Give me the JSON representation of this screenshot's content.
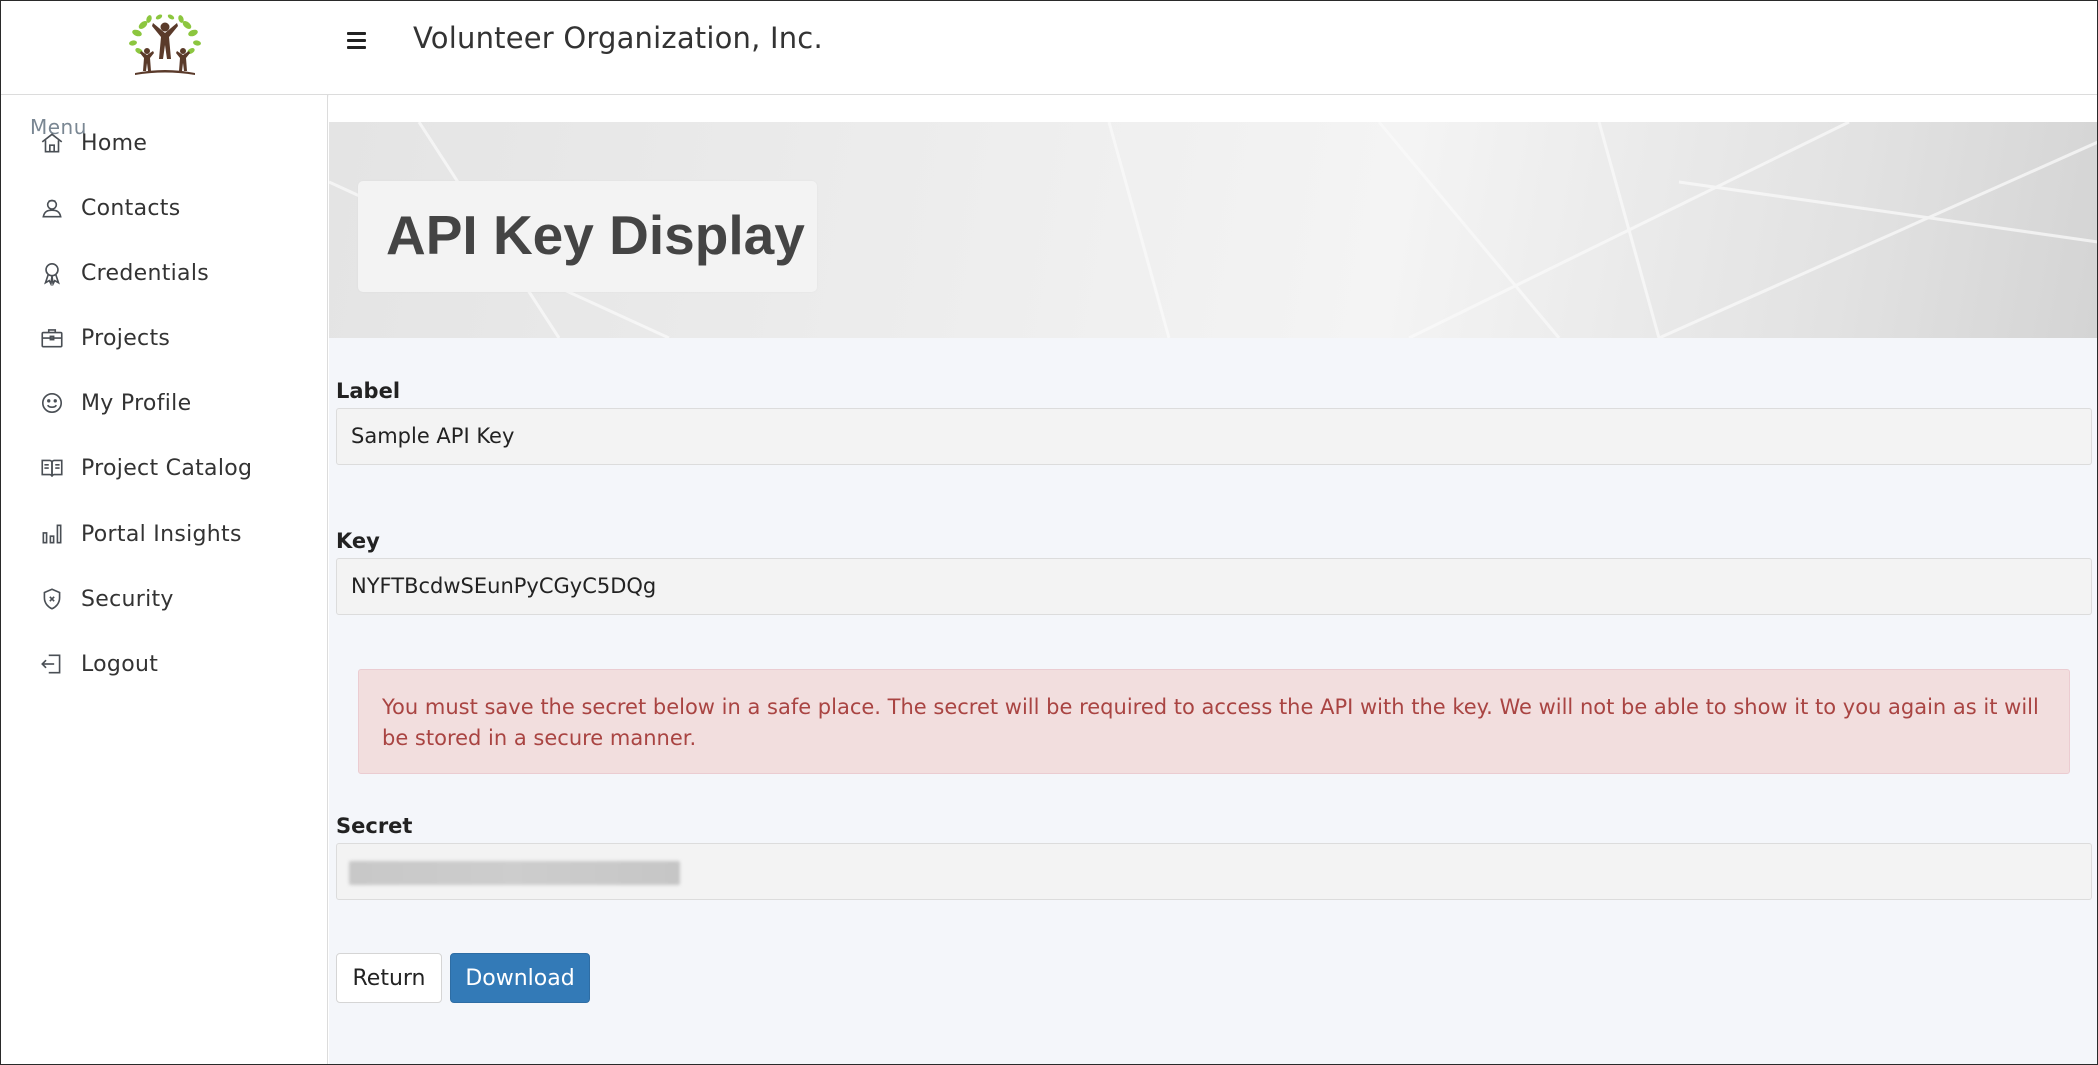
{
  "header": {
    "app_title": "Volunteer Organization, Inc."
  },
  "sidebar": {
    "menu_label": "Menu",
    "items": [
      {
        "label": "Home",
        "icon": "home-icon"
      },
      {
        "label": "Contacts",
        "icon": "contacts-icon"
      },
      {
        "label": "Credentials",
        "icon": "award-icon"
      },
      {
        "label": "Projects",
        "icon": "briefcase-icon"
      },
      {
        "label": "My Profile",
        "icon": "smiley-icon"
      },
      {
        "label": "Project Catalog",
        "icon": "book-icon"
      },
      {
        "label": "Portal Insights",
        "icon": "bar-chart-icon"
      },
      {
        "label": "Security",
        "icon": "shield-icon"
      },
      {
        "label": "Logout",
        "icon": "logout-icon"
      }
    ]
  },
  "main": {
    "page_title": "API Key Display",
    "label_field": {
      "label": "Label",
      "value": "Sample API Key"
    },
    "key_field": {
      "label": "Key",
      "value": "NYFTBcdwSEunPyCGyC5DQg"
    },
    "alert_text": "You must save the secret below in a safe place. The secret will be required to access the API with the key. We will not be able to show it to you again as it will be stored in a secure manner.",
    "secret_field": {
      "label": "Secret"
    },
    "buttons": {
      "return_label": "Return",
      "download_label": "Download"
    }
  },
  "colors": {
    "primary_button": "#337ab7",
    "alert_background": "#f2dede",
    "alert_text": "#a94442",
    "logo_leaf": "#8cc63f",
    "logo_people": "#5a3a2a"
  }
}
